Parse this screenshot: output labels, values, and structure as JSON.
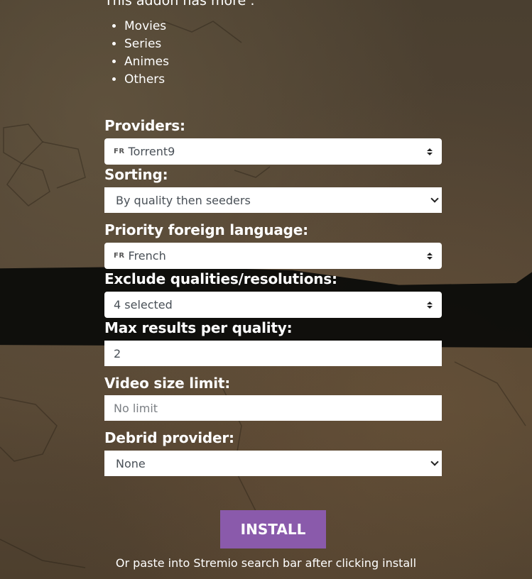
{
  "intro": {
    "text": "This addon has more :",
    "types": [
      "Movies",
      "Series",
      "Animes",
      "Others"
    ]
  },
  "form": {
    "providers": {
      "label": "Providers:",
      "flag": "FR",
      "value": "Torrent9",
      "icon": "updown-arrows-icon"
    },
    "sorting": {
      "label": "Sorting:",
      "value": "By quality then seeders",
      "icon": "chevron-down-icon"
    },
    "priority_language": {
      "label": "Priority foreign language:",
      "flag": "FR",
      "value": "French",
      "icon": "updown-arrows-icon"
    },
    "exclude_qualities": {
      "label": "Exclude qualities/resolutions:",
      "value": "4 selected",
      "icon": "updown-arrows-icon"
    },
    "max_results": {
      "label": "Max results per quality:",
      "value": "2"
    },
    "video_size_limit": {
      "label": "Video size limit:",
      "value": "",
      "placeholder": "No limit"
    },
    "debrid_provider": {
      "label": "Debrid provider:",
      "value": "None",
      "icon": "chevron-down-icon"
    }
  },
  "install": {
    "label": "INSTALL",
    "hint": "Or paste into Stremio search bar after clicking install",
    "color": "#8a5aab"
  }
}
